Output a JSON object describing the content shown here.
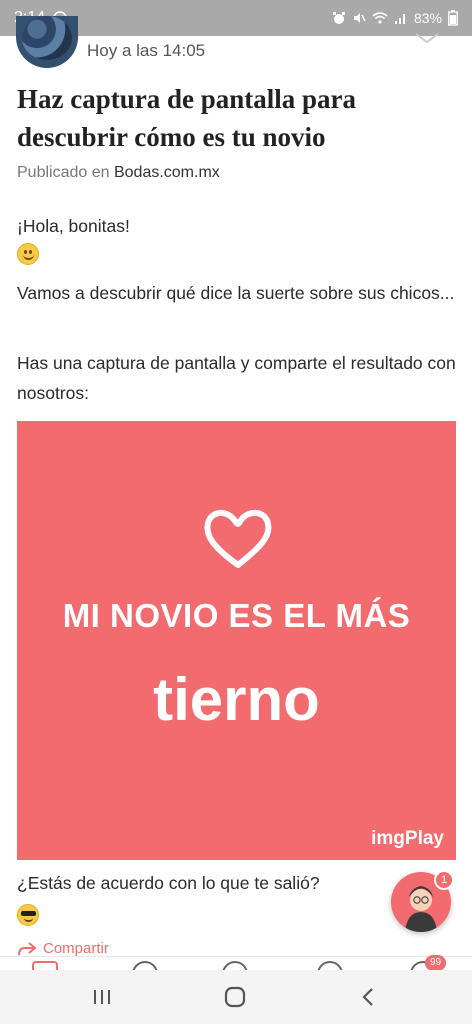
{
  "status_bar": {
    "time": "2:14",
    "battery": "83%",
    "icons": [
      "alarm-icon",
      "mute-icon",
      "wifi-icon",
      "signal-icon",
      "battery-icon"
    ]
  },
  "post": {
    "time": "Hoy a las 14:05",
    "title": "Haz captura de pantalla para descubrir cómo es tu novio",
    "published_prefix": "Publicado en",
    "published_site": "Bodas.com.mx",
    "greeting": "¡Hola, bonitas!",
    "paragraph_1": "Vamos a descubrir qué dice la suerte sobre sus chicos...",
    "paragraph_2": "Has una captura de pantalla y comparte el resultado con nosotros:",
    "question": "¿Estás de acuerdo con lo que te salió?",
    "share_label": "Compartir"
  },
  "promo_image": {
    "line_1": "MI NOVIO ES EL MÁS",
    "line_2": "tierno",
    "brand": "imgPlay",
    "background_color": "#f26b6f"
  },
  "chat": {
    "badge_count": "1"
  },
  "bottom_tabs": {
    "badge_count": "99"
  },
  "colors": {
    "accent": "#f26b6f",
    "status_bar": "#a9a9a9"
  }
}
